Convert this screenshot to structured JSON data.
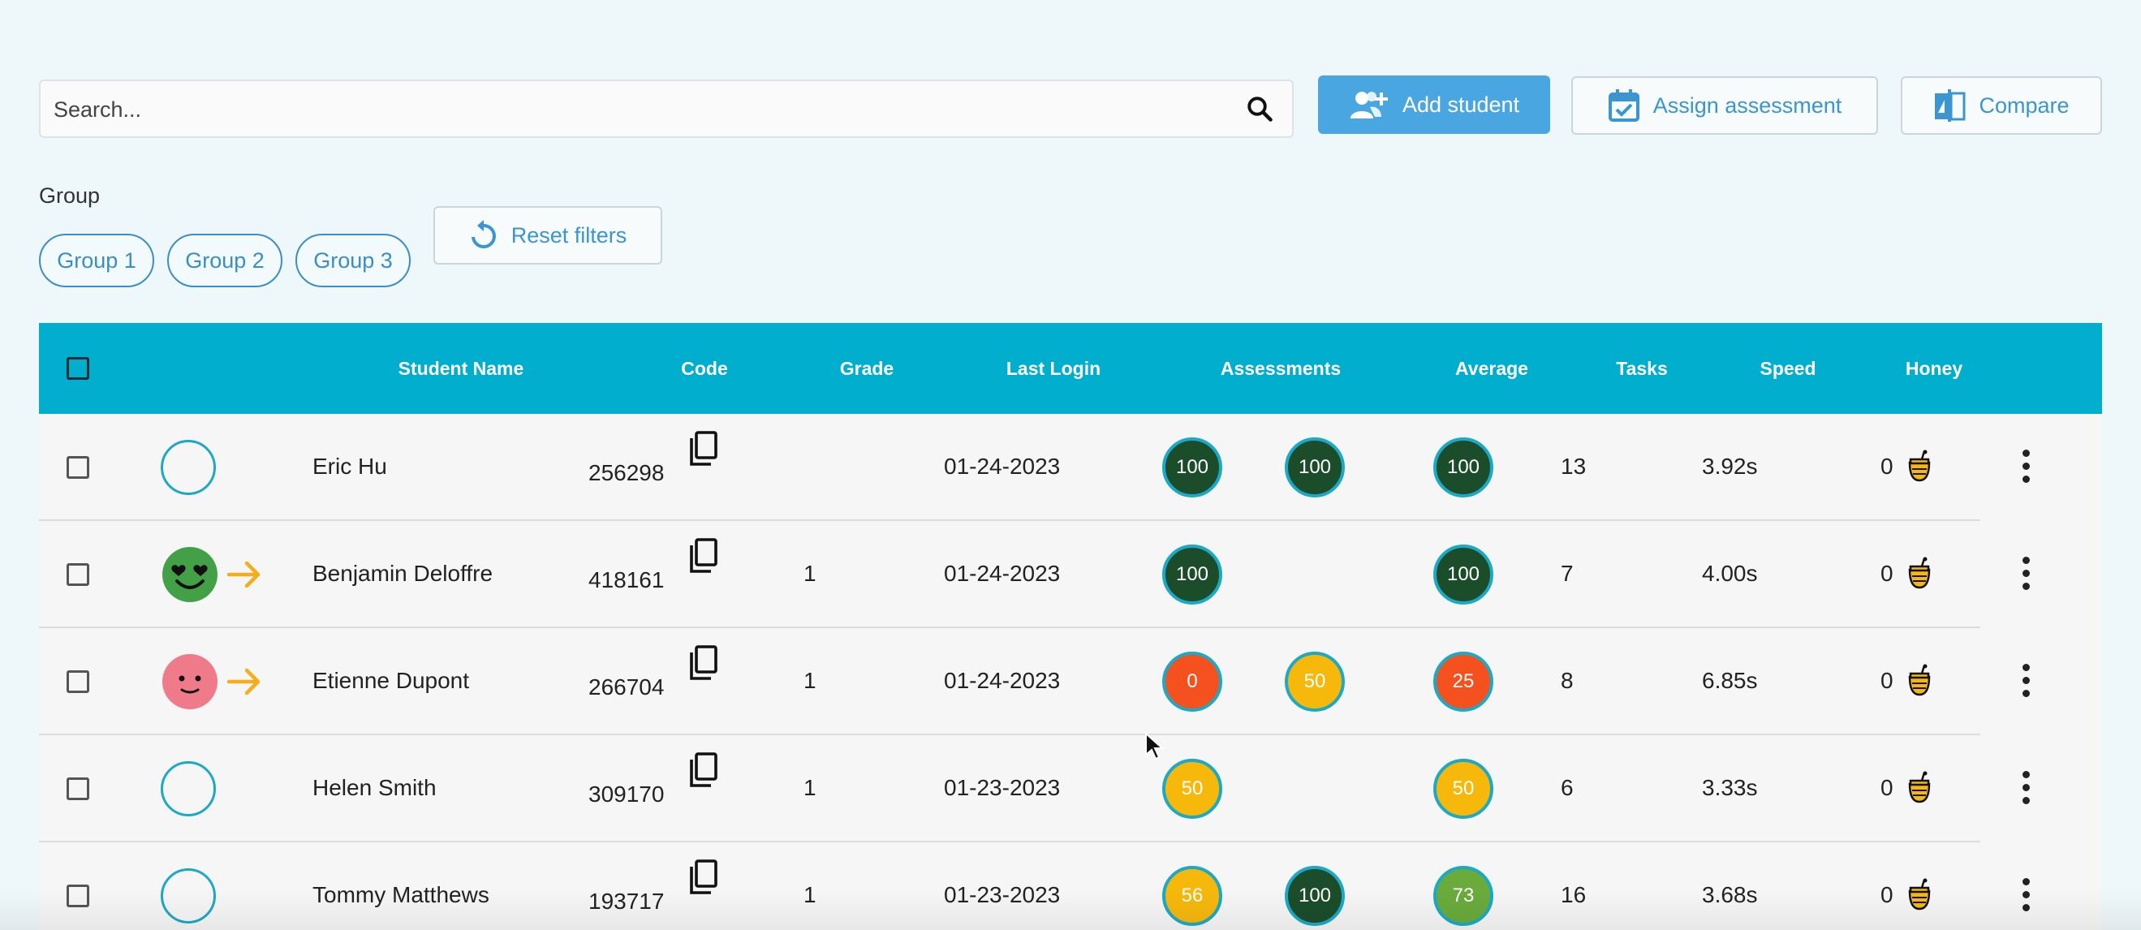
{
  "search": {
    "placeholder": "Search..."
  },
  "toolbar": {
    "add_student": "Add student",
    "assign_assessment": "Assign assessment",
    "compare": "Compare",
    "reset_filters": "Reset filters"
  },
  "filters": {
    "group_label": "Group",
    "groups": [
      "Group 1",
      "Group 2",
      "Group 3"
    ]
  },
  "colors": {
    "header_bg": "#02aece",
    "primary": "#4aa6e0",
    "badge_dark_green": "#1b4d2b",
    "badge_red": "#f4511e",
    "badge_yellow": "#f7b80c",
    "badge_light_green": "#6aab3c",
    "arrow_orange": "#f5ae1b"
  },
  "table": {
    "headers": {
      "student_name": "Student Name",
      "code": "Code",
      "grade": "Grade",
      "last_login": "Last Login",
      "assessments": "Assessments",
      "average": "Average",
      "tasks": "Tasks",
      "speed": "Speed",
      "honey": "Honey"
    },
    "rows": [
      {
        "name": "Eric Hu",
        "code": "256298",
        "grade": "",
        "last_login": "01-24-2023",
        "avatar": "empty-ring",
        "arrow": false,
        "assessments": [
          {
            "v": "100",
            "c": "#1b4d2b"
          },
          {
            "v": "100",
            "c": "#1b4d2b"
          }
        ],
        "average": {
          "v": "100",
          "c": "#1b4d2b"
        },
        "tasks": "13",
        "speed": "3.92s",
        "honey": "0"
      },
      {
        "name": "Benjamin Deloffre",
        "code": "418161",
        "grade": "1",
        "last_login": "01-24-2023",
        "avatar": "heart-eyes-green",
        "arrow": true,
        "assessments": [
          {
            "v": "100",
            "c": "#1b4d2b"
          }
        ],
        "average": {
          "v": "100",
          "c": "#1b4d2b"
        },
        "tasks": "7",
        "speed": "4.00s",
        "honey": "0"
      },
      {
        "name": "Etienne Dupont",
        "code": "266704",
        "grade": "1",
        "last_login": "01-24-2023",
        "avatar": "smile-pink",
        "arrow": true,
        "assessments": [
          {
            "v": "0",
            "c": "#f4511e"
          },
          {
            "v": "50",
            "c": "#f7b80c"
          }
        ],
        "average": {
          "v": "25",
          "c": "#f4511e"
        },
        "tasks": "8",
        "speed": "6.85s",
        "honey": "0"
      },
      {
        "name": "Helen Smith",
        "code": "309170",
        "grade": "1",
        "last_login": "01-23-2023",
        "avatar": "empty-ring",
        "arrow": false,
        "assessments": [
          {
            "v": "50",
            "c": "#f7b80c"
          }
        ],
        "average": {
          "v": "50",
          "c": "#f7b80c"
        },
        "tasks": "6",
        "speed": "3.33s",
        "honey": "0"
      },
      {
        "name": "Tommy Matthews",
        "code": "193717",
        "grade": "1",
        "last_login": "01-23-2023",
        "avatar": "empty-ring",
        "arrow": false,
        "assessments": [
          {
            "v": "56",
            "c": "#f7b80c"
          },
          {
            "v": "100",
            "c": "#1b4d2b"
          }
        ],
        "average": {
          "v": "73",
          "c": "#6aab3c"
        },
        "tasks": "16",
        "speed": "3.68s",
        "honey": "0"
      }
    ]
  }
}
